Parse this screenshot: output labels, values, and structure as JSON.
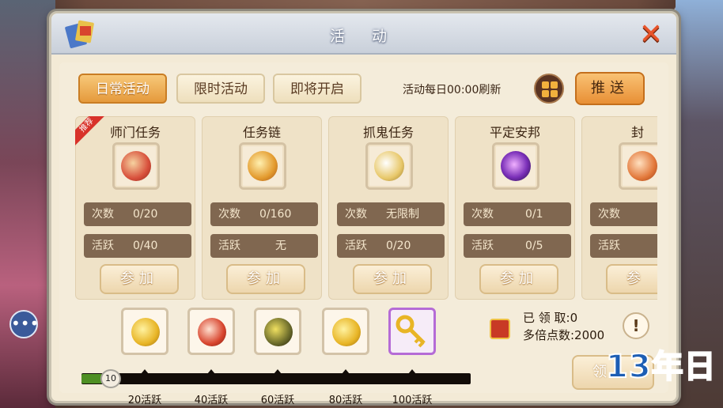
{
  "dialog": {
    "title": "活 动"
  },
  "tabs": [
    {
      "label": "日常活动",
      "active": true
    },
    {
      "label": "限时活动",
      "active": false
    },
    {
      "label": "即将开启",
      "active": false
    }
  ],
  "header": {
    "refresh_text": "活动每日00:00刷新",
    "push_label": "推送"
  },
  "activities": [
    {
      "name": "师门任务",
      "badge": "推荐",
      "count_label": "次数",
      "count_value": "0/20",
      "active_label": "活跃",
      "active_value": "0/40",
      "join_label": "参加",
      "icon_color": "#d8503c"
    },
    {
      "name": "任务链",
      "badge": "",
      "count_label": "次数",
      "count_value": "0/160",
      "active_label": "活跃",
      "active_value": "无",
      "join_label": "参加",
      "icon_color": "#e39a2d"
    },
    {
      "name": "抓鬼任务",
      "badge": "",
      "count_label": "次数",
      "count_value": "无限制",
      "active_label": "活跃",
      "active_value": "0/20",
      "join_label": "参加",
      "icon_color": "#e8c86a"
    },
    {
      "name": "平定安邦",
      "badge": "",
      "count_label": "次数",
      "count_value": "0/1",
      "active_label": "活跃",
      "active_value": "0/5",
      "join_label": "参加",
      "icon_color": "#7a2fb8"
    },
    {
      "name": "封",
      "badge": "",
      "count_label": "次数",
      "count_value": "",
      "active_label": "活跃",
      "active_value": "",
      "join_label": "参",
      "icon_color": "#e2783a"
    }
  ],
  "rewards": {
    "current_progress": "10",
    "progress_fraction": 0.06,
    "milestones": [
      {
        "label": "20活跃",
        "icon": "gold-coin-icon",
        "color": "#e8b526"
      },
      {
        "label": "40活跃",
        "icon": "red-orb-icon",
        "color": "#d8452e"
      },
      {
        "label": "60活跃",
        "icon": "dark-gem-icon",
        "color": "#6a6a2a"
      },
      {
        "label": "80活跃",
        "icon": "gold-coin-icon",
        "color": "#e8b526"
      },
      {
        "label": "100活跃",
        "icon": "golden-key-icon",
        "color": "#e8b526"
      }
    ],
    "claimed": "已 领 取:0",
    "multi_points": "多倍点数:2000",
    "claim_label": "领"
  },
  "watermark": "13年日",
  "colors": {
    "active_tab": "#e59a3c",
    "stat_bg": "#806750",
    "progress_fill": "#4e8f23"
  }
}
